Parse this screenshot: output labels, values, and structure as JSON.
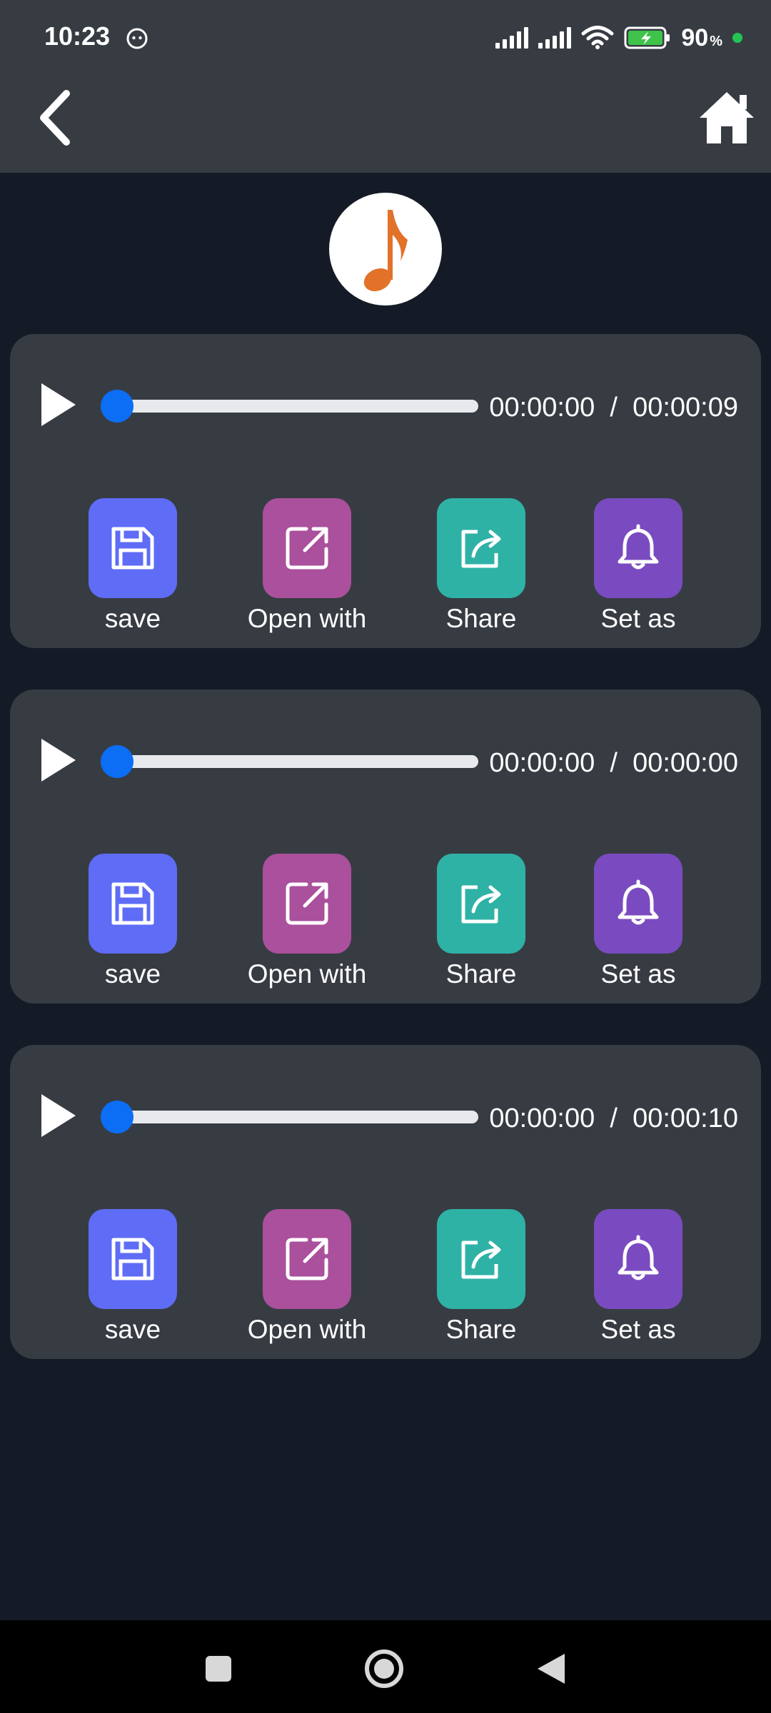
{
  "status": {
    "time": "10:23",
    "battery": "90",
    "battery_unit": "%"
  },
  "toolbar": {
    "back_icon": "chevron-left-icon",
    "home_icon": "home-icon"
  },
  "logo": {
    "icon": "music-note-icon",
    "color": "#e2722a"
  },
  "players": [
    {
      "current": "00:00:00",
      "separator": "/",
      "total": "00:00:09",
      "progress": 0,
      "actions": [
        {
          "label": "save",
          "icon": "floppy-disk-icon",
          "color": "#5f6cf6"
        },
        {
          "label": "Open with",
          "icon": "open-external-icon",
          "color": "#aa509c"
        },
        {
          "label": "Share",
          "icon": "share-icon",
          "color": "#2fb2a6"
        },
        {
          "label": "Set as",
          "icon": "bell-icon",
          "color": "#7a4bc0"
        }
      ]
    },
    {
      "current": "00:00:00",
      "separator": "/",
      "total": "00:00:00",
      "progress": 0,
      "actions": [
        {
          "label": "save",
          "icon": "floppy-disk-icon",
          "color": "#5f6cf6"
        },
        {
          "label": "Open with",
          "icon": "open-external-icon",
          "color": "#aa509c"
        },
        {
          "label": "Share",
          "icon": "share-icon",
          "color": "#2fb2a6"
        },
        {
          "label": "Set as",
          "icon": "bell-icon",
          "color": "#7a4bc0"
        }
      ]
    },
    {
      "current": "00:00:00",
      "separator": "/",
      "total": "00:00:10",
      "progress": 0,
      "actions": [
        {
          "label": "save",
          "icon": "floppy-disk-icon",
          "color": "#5f6cf6"
        },
        {
          "label": "Open with",
          "icon": "open-external-icon",
          "color": "#aa509c"
        },
        {
          "label": "Share",
          "icon": "share-icon",
          "color": "#2fb2a6"
        },
        {
          "label": "Set as",
          "icon": "bell-icon",
          "color": "#7a4bc0"
        }
      ]
    }
  ],
  "colors": {
    "background": "#151b26",
    "card": "#373c43",
    "accent": "#0b6ef5"
  }
}
